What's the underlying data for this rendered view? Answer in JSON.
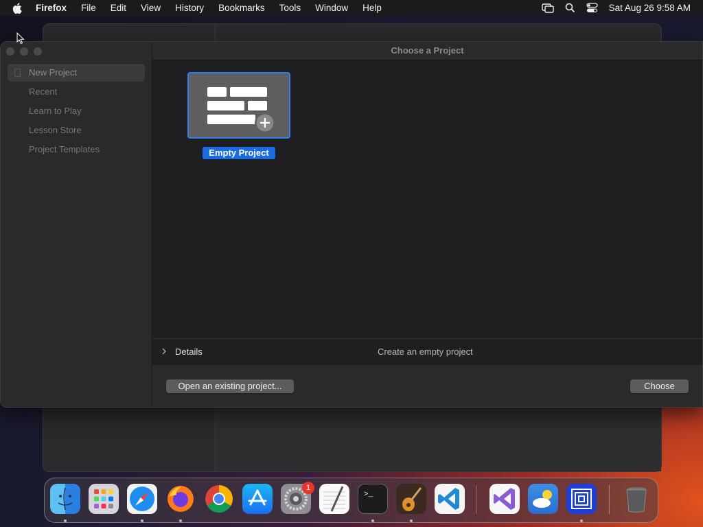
{
  "menubar": {
    "app_name": "Firefox",
    "menus": [
      "File",
      "Edit",
      "View",
      "History",
      "Bookmarks",
      "Tools",
      "Window",
      "Help"
    ],
    "clock": "Sat Aug 26  9:58 AM",
    "status_icons": [
      "screen-mirroring-icon",
      "spotlight-search-icon",
      "control-center-icon"
    ]
  },
  "dialog": {
    "title": "Choose a Project",
    "sidebar": [
      {
        "label": "New Project",
        "selected": true
      },
      {
        "label": "Recent",
        "selected": false
      },
      {
        "label": "Learn to Play",
        "selected": false
      },
      {
        "label": "Lesson Store",
        "selected": false
      },
      {
        "label": "Project Templates",
        "selected": false
      }
    ],
    "tile_label": "Empty Project",
    "details_label": "Details",
    "details_description": "Create an empty project",
    "open_existing_label": "Open an existing project...",
    "choose_label": "Choose"
  },
  "dock": {
    "apps": [
      "Finder",
      "Launchpad",
      "Safari",
      "Firefox",
      "Chrome",
      "App Store",
      "System Preferences",
      "TextEdit",
      "Terminal",
      "GarageBand",
      "Visual Studio Code",
      "Visual Studio",
      "Weather",
      "Screen Recorder",
      "Trash"
    ],
    "settings_badge": "1"
  },
  "colors": {
    "accent": "#1a6be0",
    "selection_border": "#2f7ef0",
    "window_bg": "#1f1f21",
    "sidebar_bg": "#2a2a2c"
  }
}
